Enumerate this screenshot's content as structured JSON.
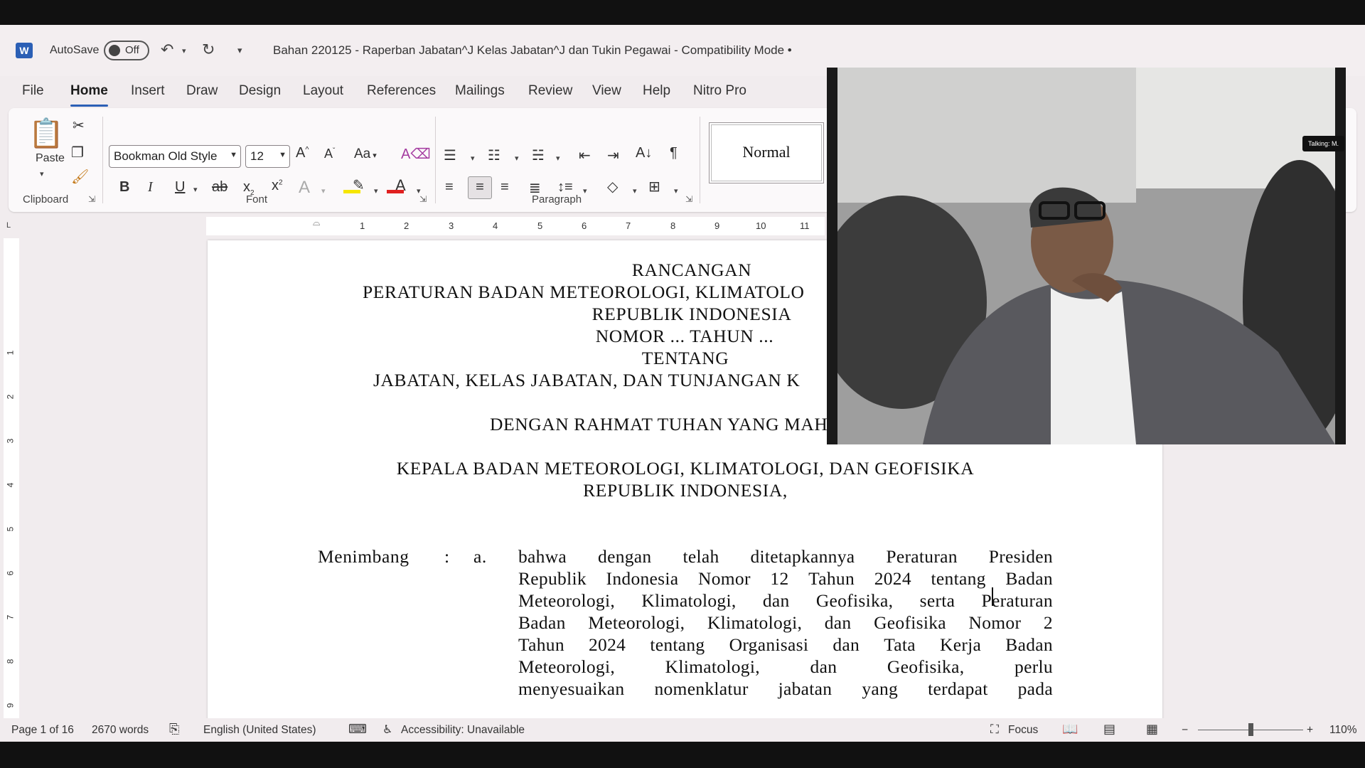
{
  "app": {
    "autosave_label": "AutoSave",
    "autosave_state": "Off",
    "doc_title": "Bahan 220125 - Raperban Jabatan^J Kelas Jabatan^J dan Tukin Pegawai  -  Compatibility Mode  •"
  },
  "tabs": [
    "File",
    "Home",
    "Insert",
    "Draw",
    "Design",
    "Layout",
    "References",
    "Mailings",
    "Review",
    "View",
    "Help",
    "Nitro Pro"
  ],
  "ribbon": {
    "paste_label": "Paste",
    "clipboard_label": "Clipboard",
    "font_label": "Font",
    "paragraph_label": "Paragraph",
    "font_name": "Bookman Old Style",
    "font_size": "12",
    "change_case": "Aa",
    "style_normal": "Normal"
  },
  "ruler": {
    "numbers": [
      "1",
      "2",
      "3",
      "4",
      "5",
      "6",
      "7",
      "8",
      "9",
      "10",
      "11"
    ],
    "vnumbers": [
      "1",
      "2",
      "3",
      "4",
      "5",
      "6",
      "7",
      "8",
      "9"
    ]
  },
  "document": {
    "line1": "RANCANGAN",
    "line2": "PERATURAN BADAN METEOROLOGI, KLIMATOLO",
    "line3": "REPUBLIK INDONESIA",
    "line4": "NOMOR ... TAHUN ...",
    "line5": "TENTANG",
    "line6": "JABATAN, KELAS JABATAN, DAN TUNJANGAN K",
    "line7": "DENGAN RAHMAT TUHAN YANG MAHA ESA",
    "line8": "KEPALA BADAN METEOROLOGI, KLIMATOLOGI, DAN GEOFISIKA",
    "line9": "REPUBLIK INDONESIA,",
    "menimbang": "Menimbang",
    "colon": ":",
    "item": "a.",
    "body": [
      "bahwa dengan telah ditetapkannya Peraturan Presiden",
      "Republik Indonesia Nomor 12 Tahun 2024 tentang Badan",
      "Meteorologi, Klimatologi, dan Geofisika, serta Peraturan",
      "Badan Meteorologi, Klimatologi, dan Geofisika Nomor 2",
      "Tahun 2024 tentang Organisasi dan Tata Kerja Badan",
      "Meteorologi, Klimatologi, dan Geofisika, perlu",
      "menyesuaikan nomenklatur jabatan yang terdapat pada"
    ]
  },
  "status": {
    "page": "Page 1 of 16",
    "words": "2670 words",
    "language": "English (United States)",
    "accessibility": "Accessibility: Unavailable",
    "focus": "Focus",
    "zoom_minus": "−",
    "zoom_plus": "+",
    "zoom": "110%"
  },
  "video": {
    "talking": "Talking: M."
  },
  "colors": {
    "accent": "#2b5fb5",
    "highlight": "#f6e600",
    "font_color": "#e02020"
  }
}
